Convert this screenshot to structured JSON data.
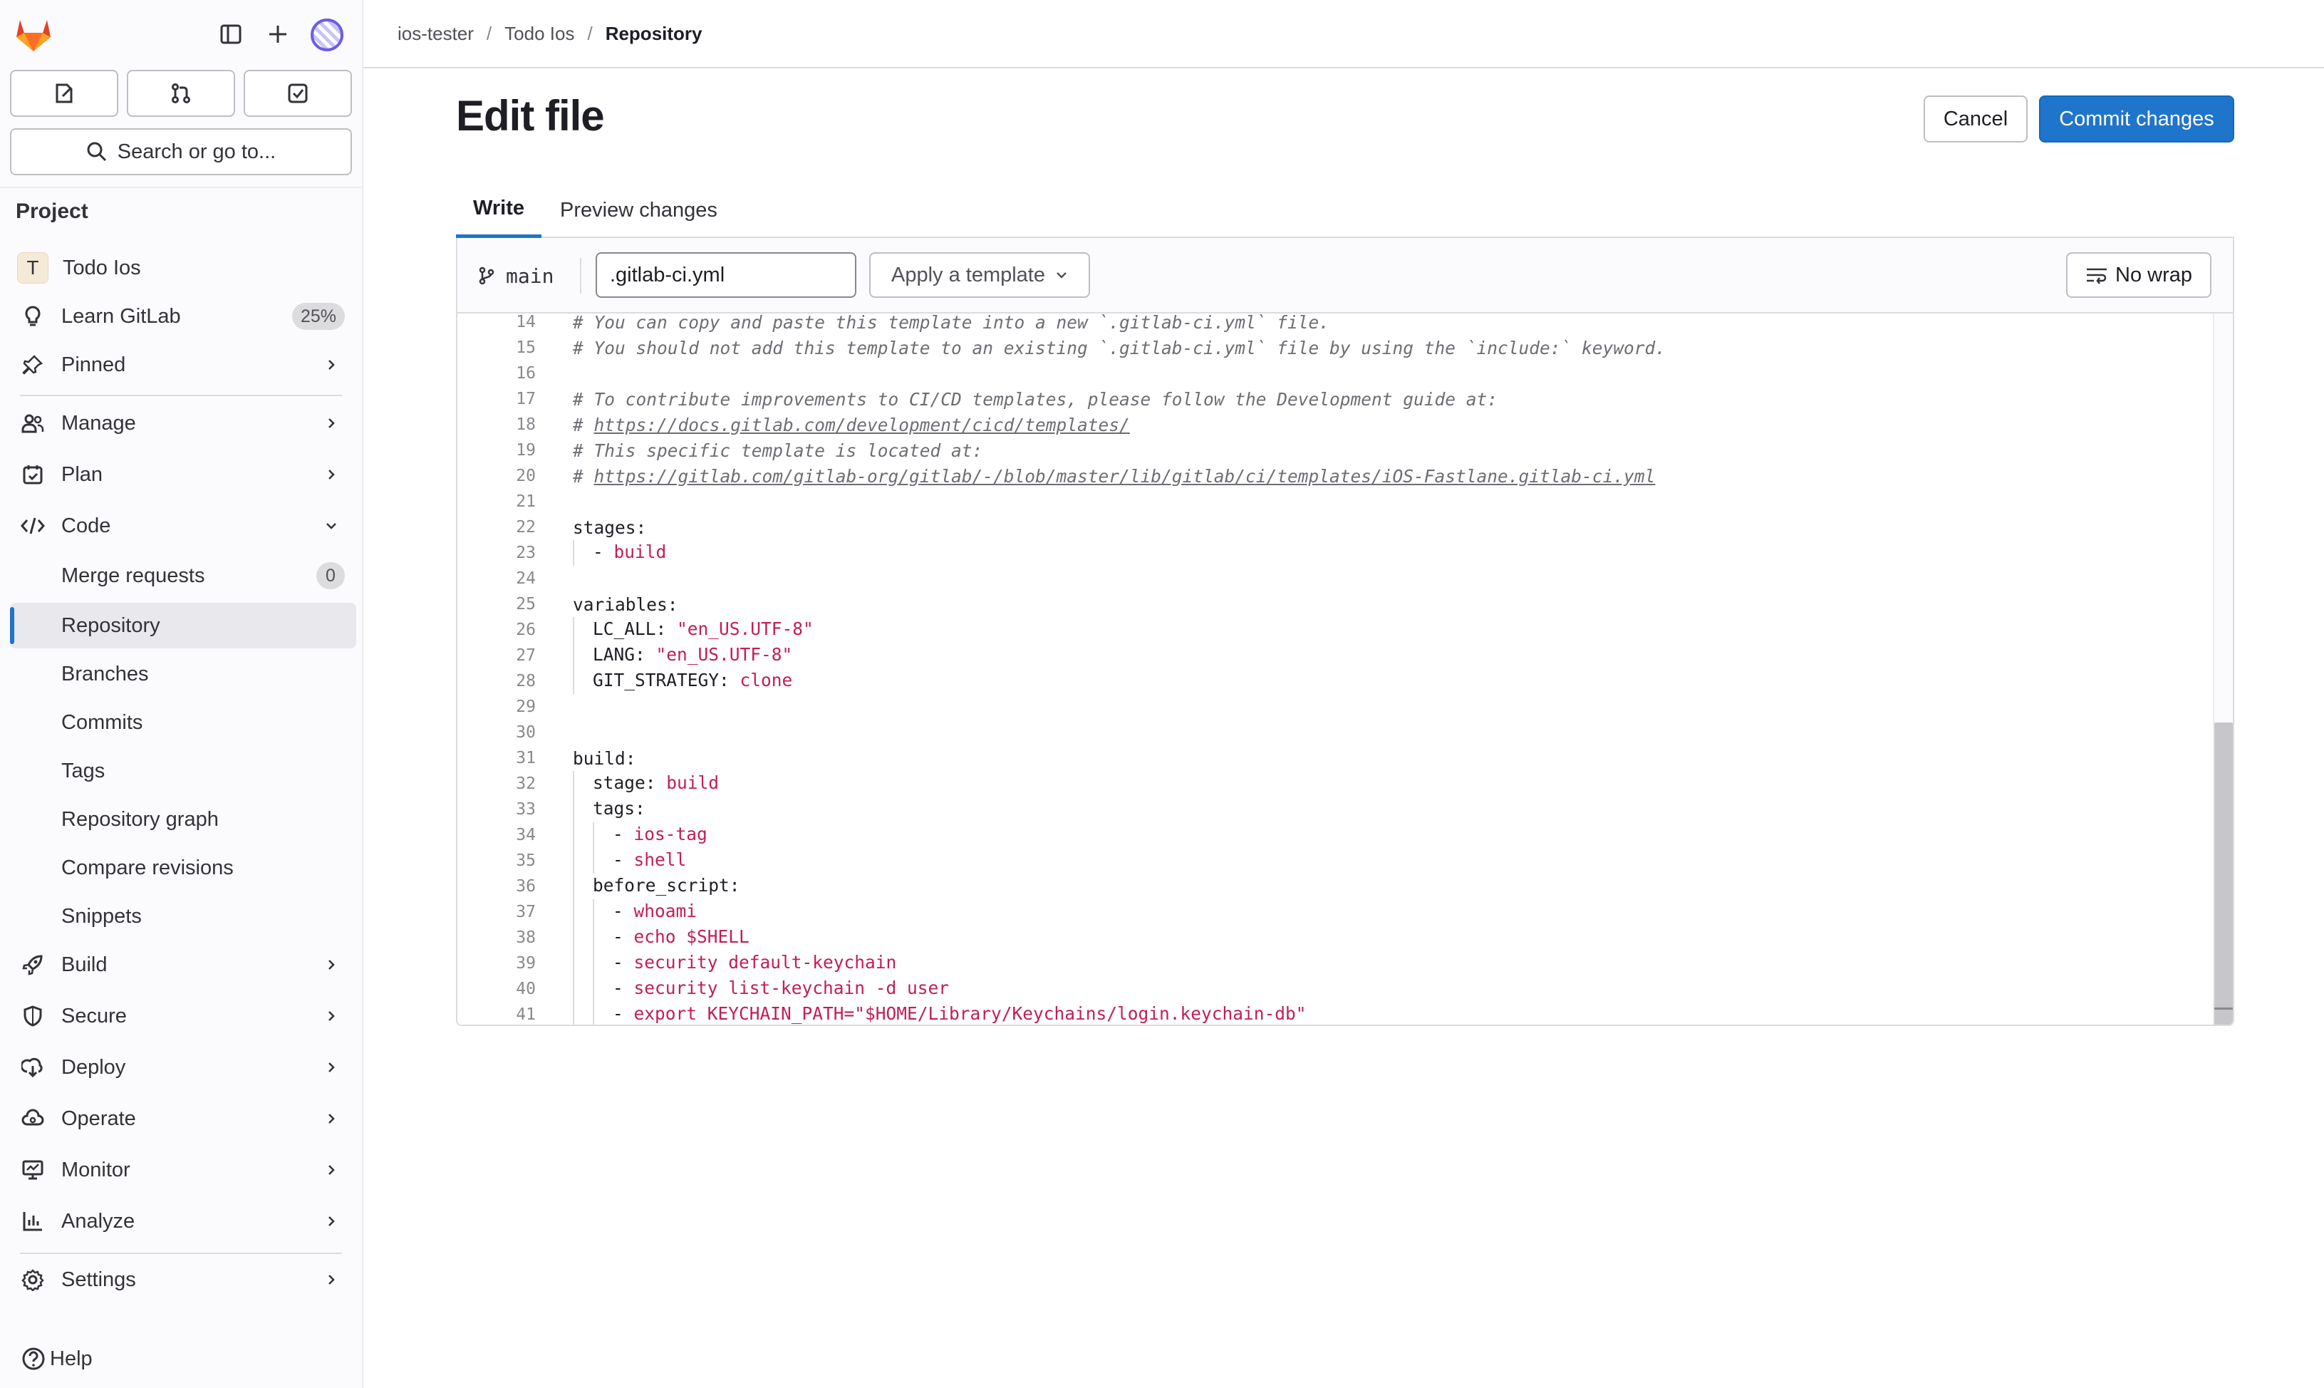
{
  "sidebar": {
    "search_label": "Search or go to...",
    "section_title": "Project",
    "project_name": "Todo Ios",
    "project_initial": "T",
    "learn_label": "Learn GitLab",
    "learn_badge": "25%",
    "pinned_label": "Pinned",
    "manage_label": "Manage",
    "plan_label": "Plan",
    "code_label": "Code",
    "code_items": [
      {
        "label": "Merge requests",
        "badge": "0"
      },
      {
        "label": "Repository"
      },
      {
        "label": "Branches"
      },
      {
        "label": "Commits"
      },
      {
        "label": "Tags"
      },
      {
        "label": "Repository graph"
      },
      {
        "label": "Compare revisions"
      },
      {
        "label": "Snippets"
      }
    ],
    "build_label": "Build",
    "secure_label": "Secure",
    "deploy_label": "Deploy",
    "operate_label": "Operate",
    "monitor_label": "Monitor",
    "analyze_label": "Analyze",
    "settings_label": "Settings",
    "help_label": "Help"
  },
  "breadcrumb": {
    "items": [
      "ios-tester",
      "Todo Ios",
      "Repository"
    ]
  },
  "page": {
    "title": "Edit file",
    "cancel_label": "Cancel",
    "commit_label": "Commit changes",
    "tabs": [
      "Write",
      "Preview changes"
    ]
  },
  "editor": {
    "branch": "main",
    "filename": ".gitlab-ci.yml",
    "template_label": "Apply a template",
    "wrap_label": "No wrap",
    "lines": [
      {
        "n": "14",
        "parts": [
          {
            "t": "# You can copy and paste this template into a new `.gitlab-ci.yml` file.",
            "c": "c-comment"
          }
        ]
      },
      {
        "n": "15",
        "parts": [
          {
            "t": "# You should not add this template to an existing `.gitlab-ci.yml` file by using the `include:` keyword.",
            "c": "c-comment"
          }
        ]
      },
      {
        "n": "16",
        "parts": []
      },
      {
        "n": "17",
        "parts": [
          {
            "t": "# To contribute improvements to CI/CD templates, please follow the Development guide at:",
            "c": "c-comment"
          }
        ]
      },
      {
        "n": "18",
        "parts": [
          {
            "t": "# ",
            "c": "c-comment"
          },
          {
            "t": "https://docs.gitlab.com/development/cicd/templates/",
            "c": "c-link"
          }
        ]
      },
      {
        "n": "19",
        "parts": [
          {
            "t": "# This specific template is located at:",
            "c": "c-comment"
          }
        ]
      },
      {
        "n": "20",
        "parts": [
          {
            "t": "# ",
            "c": "c-comment"
          },
          {
            "t": "https://gitlab.com/gitlab-org/gitlab/-/blob/master/lib/gitlab/ci/templates/iOS-Fastlane.gitlab-ci.yml",
            "c": "c-link"
          }
        ]
      },
      {
        "n": "21",
        "parts": []
      },
      {
        "n": "22",
        "parts": [
          {
            "t": "stages:",
            "c": "c-key"
          }
        ]
      },
      {
        "n": "23",
        "indent": 1,
        "parts": [
          {
            "t": "- ",
            "c": "c-key"
          },
          {
            "t": "build",
            "c": "c-str"
          }
        ]
      },
      {
        "n": "24",
        "parts": []
      },
      {
        "n": "25",
        "parts": [
          {
            "t": "variables:",
            "c": "c-key"
          }
        ]
      },
      {
        "n": "26",
        "indent": 1,
        "parts": [
          {
            "t": "LC_ALL: ",
            "c": "c-key"
          },
          {
            "t": "\"en_US.UTF-8\"",
            "c": "c-str"
          }
        ]
      },
      {
        "n": "27",
        "indent": 1,
        "parts": [
          {
            "t": "LANG: ",
            "c": "c-key"
          },
          {
            "t": "\"en_US.UTF-8\"",
            "c": "c-str"
          }
        ]
      },
      {
        "n": "28",
        "indent": 1,
        "parts": [
          {
            "t": "GIT_STRATEGY: ",
            "c": "c-key"
          },
          {
            "t": "clone",
            "c": "c-str"
          }
        ]
      },
      {
        "n": "29",
        "parts": []
      },
      {
        "n": "30",
        "parts": []
      },
      {
        "n": "31",
        "parts": [
          {
            "t": "build:",
            "c": "c-key"
          }
        ]
      },
      {
        "n": "32",
        "indent": 1,
        "parts": [
          {
            "t": "stage: ",
            "c": "c-key"
          },
          {
            "t": "build",
            "c": "c-str"
          }
        ]
      },
      {
        "n": "33",
        "indent": 1,
        "parts": [
          {
            "t": "tags:",
            "c": "c-key"
          }
        ]
      },
      {
        "n": "34",
        "indent": 2,
        "parts": [
          {
            "t": "- ",
            "c": "c-key"
          },
          {
            "t": "ios-tag",
            "c": "c-str"
          }
        ]
      },
      {
        "n": "35",
        "indent": 2,
        "parts": [
          {
            "t": "- ",
            "c": "c-key"
          },
          {
            "t": "shell",
            "c": "c-str"
          }
        ]
      },
      {
        "n": "36",
        "indent": 1,
        "parts": [
          {
            "t": "before_script:",
            "c": "c-key"
          }
        ]
      },
      {
        "n": "37",
        "indent": 2,
        "parts": [
          {
            "t": "- ",
            "c": "c-key"
          },
          {
            "t": "whoami",
            "c": "c-str"
          }
        ]
      },
      {
        "n": "38",
        "indent": 2,
        "parts": [
          {
            "t": "- ",
            "c": "c-key"
          },
          {
            "t": "echo $SHELL",
            "c": "c-str"
          }
        ]
      },
      {
        "n": "39",
        "indent": 2,
        "parts": [
          {
            "t": "- ",
            "c": "c-key"
          },
          {
            "t": "security default-keychain",
            "c": "c-str"
          }
        ]
      },
      {
        "n": "40",
        "indent": 2,
        "parts": [
          {
            "t": "- ",
            "c": "c-key"
          },
          {
            "t": "security list-keychain -d user",
            "c": "c-str"
          }
        ]
      },
      {
        "n": "41",
        "indent": 2,
        "parts": [
          {
            "t": "- ",
            "c": "c-key"
          },
          {
            "t": "export KEYCHAIN_PATH=\"$HOME/Library/Keychains/login.keychain-db\"",
            "c": "c-str"
          }
        ]
      }
    ]
  },
  "colors": {
    "accent": "#1f75cb",
    "string": "#c21e56",
    "comment": "#6e6d73"
  }
}
